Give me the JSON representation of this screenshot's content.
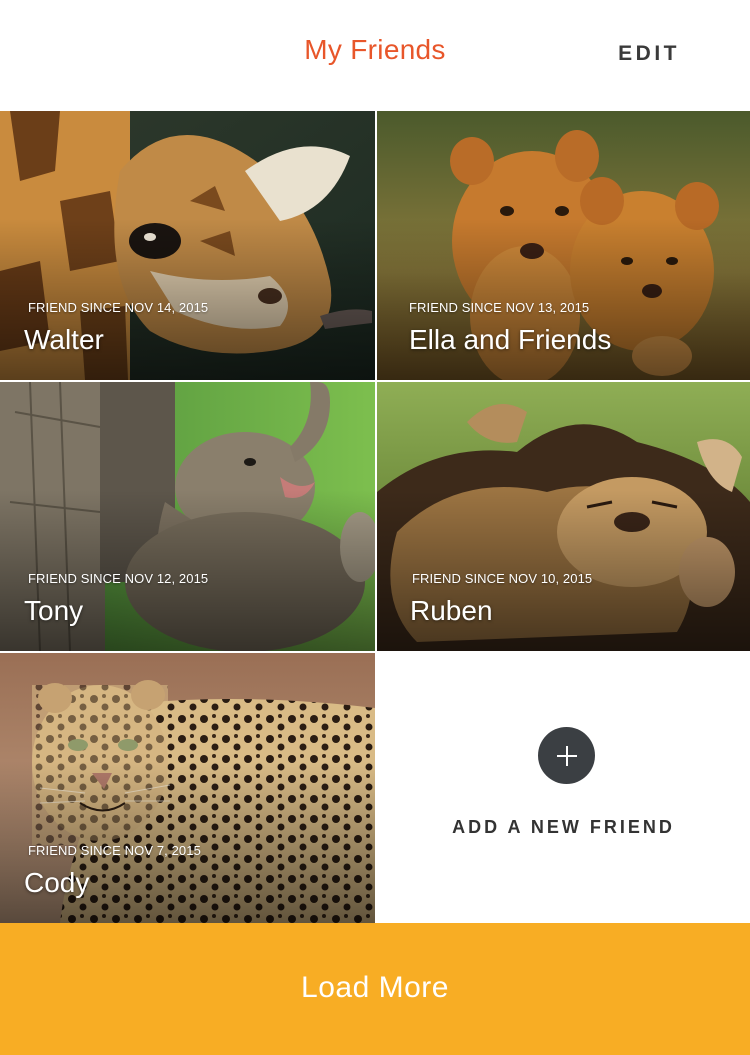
{
  "header": {
    "title": "My Friends",
    "edit_label": "EDIT"
  },
  "friends": [
    {
      "name": "Walter",
      "since": "FRIEND SINCE NOV 14, 2015",
      "animal": "giraffe"
    },
    {
      "name": "Ella and Friends",
      "since": "FRIEND SINCE NOV 13, 2015",
      "animal": "lion-cubs"
    },
    {
      "name": "Tony",
      "since": "FRIEND SINCE NOV 12, 2015",
      "animal": "baby-elephant"
    },
    {
      "name": "Ruben",
      "since": "FRIEND SINCE NOV 10, 2015",
      "animal": "lion"
    },
    {
      "name": "Cody",
      "since": "FRIEND SINCE NOV 7, 2015",
      "animal": "leopard"
    }
  ],
  "add_friend": {
    "label": "ADD A NEW FRIEND",
    "icon": "plus-icon"
  },
  "load_more_label": "Load More",
  "colors": {
    "title": "#e8562a",
    "load_more_bg": "#f8ad24",
    "plus_circle": "#3b3f43"
  }
}
